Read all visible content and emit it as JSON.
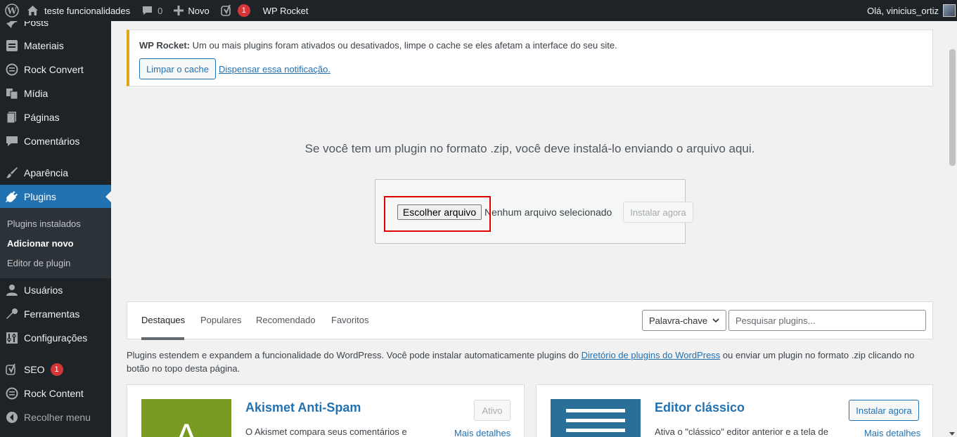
{
  "admin_bar": {
    "site_name": "teste funcionalidades",
    "comments_count": "0",
    "new_label": "Novo",
    "yoast_badge": "1",
    "rocket_label": "WP Rocket",
    "greeting": "Olá, vinicius_ortiz"
  },
  "sidebar": {
    "items": [
      {
        "label": "Posts",
        "icon": "pin-icon"
      },
      {
        "label": "Materiais",
        "icon": "archive-icon"
      },
      {
        "label": "Rock Convert",
        "icon": "target-icon"
      },
      {
        "label": "Mídia",
        "icon": "media-icon"
      },
      {
        "label": "Páginas",
        "icon": "page-icon"
      },
      {
        "label": "Comentários",
        "icon": "comment-icon"
      },
      {
        "label": "Aparência",
        "icon": "brush-icon"
      },
      {
        "label": "Plugins",
        "icon": "plug-icon"
      },
      {
        "label": "Usuários",
        "icon": "user-icon"
      },
      {
        "label": "Ferramentas",
        "icon": "wrench-icon"
      },
      {
        "label": "Configurações",
        "icon": "settings-icon"
      },
      {
        "label": "SEO",
        "icon": "yoast-icon",
        "badge": "1"
      },
      {
        "label": "Rock Content",
        "icon": "rock-icon"
      },
      {
        "label": "Recolher menu",
        "icon": "collapse-icon"
      }
    ],
    "submenu": [
      "Plugins instalados",
      "Adicionar novo",
      "Editor de plugin"
    ]
  },
  "notice": {
    "label": "WP Rocket:",
    "text": " Um ou mais plugins foram ativados ou desativados, limpe o cache se eles afetam a interface do seu site.",
    "clear_button": "Limpar o cache",
    "dismiss_link": "Dispensar essa notificação."
  },
  "upload": {
    "intro": "Se você tem um plugin no formato .zip, você deve instalá-lo enviando o arquivo aqui.",
    "choose_file": "Escolher arquivo",
    "no_file": "Nenhum arquivo selecionado",
    "install_button": "Instalar agora"
  },
  "filters": {
    "tabs": [
      "Destaques",
      "Populares",
      "Recomendado",
      "Favoritos"
    ],
    "type_select": "Palavra-chave",
    "search_placeholder": "Pesquisar plugins..."
  },
  "intro": {
    "before": "Plugins estendem e expandem a funcionalidade do WordPress. Você pode instalar automaticamente plugins do ",
    "link": "Diretório de plugins do WordPress",
    "after": " ou enviar um plugin no formato .zip clicando no botão no topo desta página."
  },
  "cards": [
    {
      "title": "Akismet Anti-Spam",
      "button": "Ativo",
      "more": "Mais detalhes",
      "desc": "O Akismet compara seus comentários e"
    },
    {
      "title": "Editor clássico",
      "button": "Instalar agora",
      "more": "Mais detalhes",
      "desc": "Ativa o \"clássico\" editor anterior e a tela de"
    }
  ],
  "colors": {
    "accent": "#2271b1",
    "sidebar_bg": "#1d2327",
    "notice_border": "#dba617",
    "badge": "#d63638",
    "highlight": "#e00000",
    "akismet": "#799b24",
    "classic_editor": "#2a6f97"
  }
}
